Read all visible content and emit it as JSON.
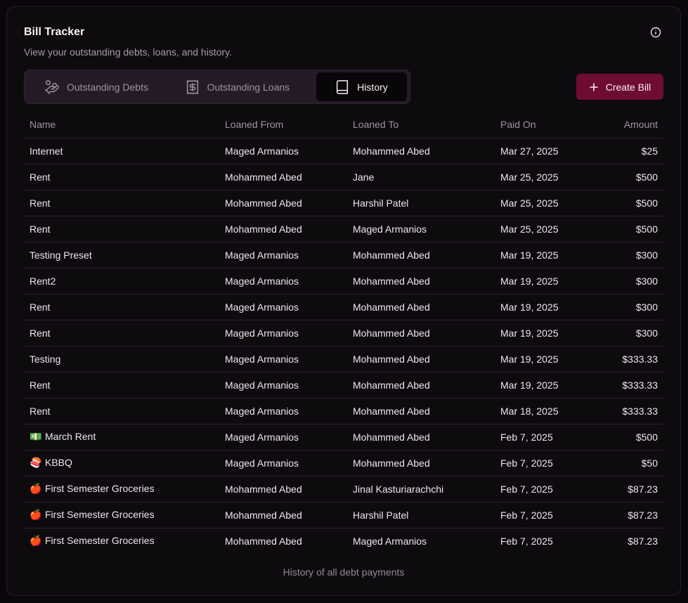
{
  "header": {
    "title": "Bill Tracker",
    "subtitle": "View your outstanding debts, loans, and history."
  },
  "tabs": [
    {
      "label": "Outstanding Debts",
      "icon": "hand-coins-icon",
      "active": false
    },
    {
      "label": "Outstanding Loans",
      "icon": "receipt-dollar-icon",
      "active": false
    },
    {
      "label": "History",
      "icon": "book-icon",
      "active": true
    }
  ],
  "create_button": {
    "label": "Create Bill",
    "icon": "plus-icon"
  },
  "table": {
    "columns": [
      "Name",
      "Loaned From",
      "Loaned To",
      "Paid On",
      "Amount"
    ],
    "rows": [
      {
        "emoji": "",
        "name": "Internet",
        "from": "Maged Armanios",
        "to": "Mohammed Abed",
        "paid_on": "Mar 27, 2025",
        "amount": "$25"
      },
      {
        "emoji": "",
        "name": "Rent",
        "from": "Mohammed Abed",
        "to": "Jane",
        "paid_on": "Mar 25, 2025",
        "amount": "$500"
      },
      {
        "emoji": "",
        "name": "Rent",
        "from": "Mohammed Abed",
        "to": "Harshil Patel",
        "paid_on": "Mar 25, 2025",
        "amount": "$500"
      },
      {
        "emoji": "",
        "name": "Rent",
        "from": "Mohammed Abed",
        "to": "Maged Armanios",
        "paid_on": "Mar 25, 2025",
        "amount": "$500"
      },
      {
        "emoji": "",
        "name": "Testing Preset",
        "from": "Maged Armanios",
        "to": "Mohammed Abed",
        "paid_on": "Mar 19, 2025",
        "amount": "$300"
      },
      {
        "emoji": "",
        "name": "Rent2",
        "from": "Maged Armanios",
        "to": "Mohammed Abed",
        "paid_on": "Mar 19, 2025",
        "amount": "$300"
      },
      {
        "emoji": "",
        "name": "Rent",
        "from": "Maged Armanios",
        "to": "Mohammed Abed",
        "paid_on": "Mar 19, 2025",
        "amount": "$300"
      },
      {
        "emoji": "",
        "name": "Rent",
        "from": "Maged Armanios",
        "to": "Mohammed Abed",
        "paid_on": "Mar 19, 2025",
        "amount": "$300"
      },
      {
        "emoji": "",
        "name": "Testing",
        "from": "Maged Armanios",
        "to": "Mohammed Abed",
        "paid_on": "Mar 19, 2025",
        "amount": "$333.33"
      },
      {
        "emoji": "",
        "name": "Rent",
        "from": "Maged Armanios",
        "to": "Mohammed Abed",
        "paid_on": "Mar 19, 2025",
        "amount": "$333.33"
      },
      {
        "emoji": "",
        "name": "Rent",
        "from": "Maged Armanios",
        "to": "Mohammed Abed",
        "paid_on": "Mar 18, 2025",
        "amount": "$333.33"
      },
      {
        "emoji": "💵",
        "name": "March Rent",
        "from": "Maged Armanios",
        "to": "Mohammed Abed",
        "paid_on": "Feb 7, 2025",
        "amount": "$500"
      },
      {
        "emoji": "🍣",
        "name": "KBBQ",
        "from": "Maged Armanios",
        "to": "Mohammed Abed",
        "paid_on": "Feb 7, 2025",
        "amount": "$50"
      },
      {
        "emoji": "🍎",
        "name": "First Semester Groceries",
        "from": "Mohammed Abed",
        "to": "Jinal Kasturiarachchi",
        "paid_on": "Feb 7, 2025",
        "amount": "$87.23"
      },
      {
        "emoji": "🍎",
        "name": "First Semester Groceries",
        "from": "Mohammed Abed",
        "to": "Harshil Patel",
        "paid_on": "Feb 7, 2025",
        "amount": "$87.23"
      },
      {
        "emoji": "🍎",
        "name": "First Semester Groceries",
        "from": "Mohammed Abed",
        "to": "Maged Armanios",
        "paid_on": "Feb 7, 2025",
        "amount": "$87.23"
      }
    ],
    "caption": "History of all debt payments"
  },
  "colors": {
    "background": "#09070a",
    "card": "#0e0b0f",
    "accent": "#6e0c33",
    "tab_bar": "#241b26",
    "muted_text": "#9b949d"
  }
}
